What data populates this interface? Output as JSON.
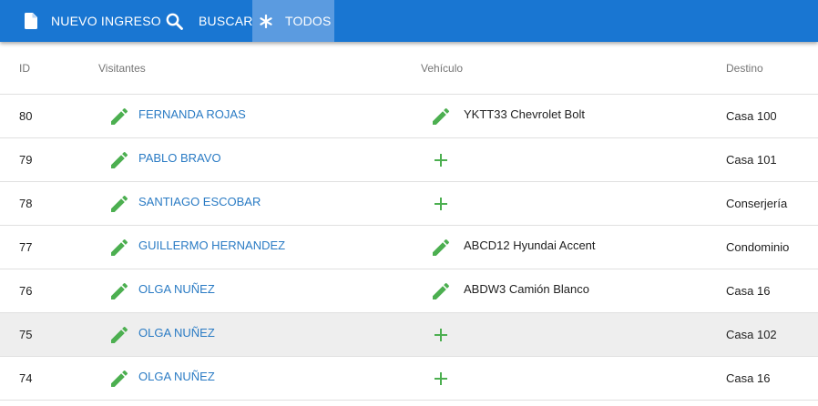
{
  "toolbar": {
    "nuevo_label": "NUEVO INGRESO",
    "buscar_label": "BUSCAR",
    "todos_label": "TODOS"
  },
  "table": {
    "headers": {
      "id": "ID",
      "visitantes": "Visitantes",
      "vehiculo": "Vehículo",
      "destino": "Destino"
    },
    "rows": [
      {
        "id": "80",
        "visitor": "FERNANDA ROJAS",
        "vehicle": "YKTT33 Chevrolet Bolt",
        "vehicle_icon": "pencil-icon",
        "destination": "Casa 100",
        "selected": false
      },
      {
        "id": "79",
        "visitor": "PABLO BRAVO",
        "vehicle": "",
        "vehicle_icon": "plus-icon",
        "destination": "Casa 101",
        "selected": false
      },
      {
        "id": "78",
        "visitor": "SANTIAGO ESCOBAR",
        "vehicle": "",
        "vehicle_icon": "plus-icon",
        "destination": "Conserjería",
        "selected": false
      },
      {
        "id": "77",
        "visitor": "GUILLERMO HERNANDEZ",
        "vehicle": "ABCD12 Hyundai Accent",
        "vehicle_icon": "pencil-icon",
        "destination": "Condominio",
        "selected": false
      },
      {
        "id": "76",
        "visitor": "OLGA NUÑEZ",
        "vehicle": "ABDW3 Camión Blanco",
        "vehicle_icon": "pencil-icon",
        "destination": "Casa 16",
        "selected": false
      },
      {
        "id": "75",
        "visitor": "OLGA NUÑEZ",
        "vehicle": "",
        "vehicle_icon": "plus-icon",
        "destination": "Casa 102",
        "selected": true
      },
      {
        "id": "74",
        "visitor": "OLGA NUÑEZ",
        "vehicle": "",
        "vehicle_icon": "plus-icon",
        "destination": "Casa 16",
        "selected": false
      }
    ]
  },
  "colors": {
    "toolbar": "#1976d2",
    "toolbar_active": "#5b9be0",
    "icon_green": "#4caf50",
    "link_blue": "#2a7bc4"
  }
}
